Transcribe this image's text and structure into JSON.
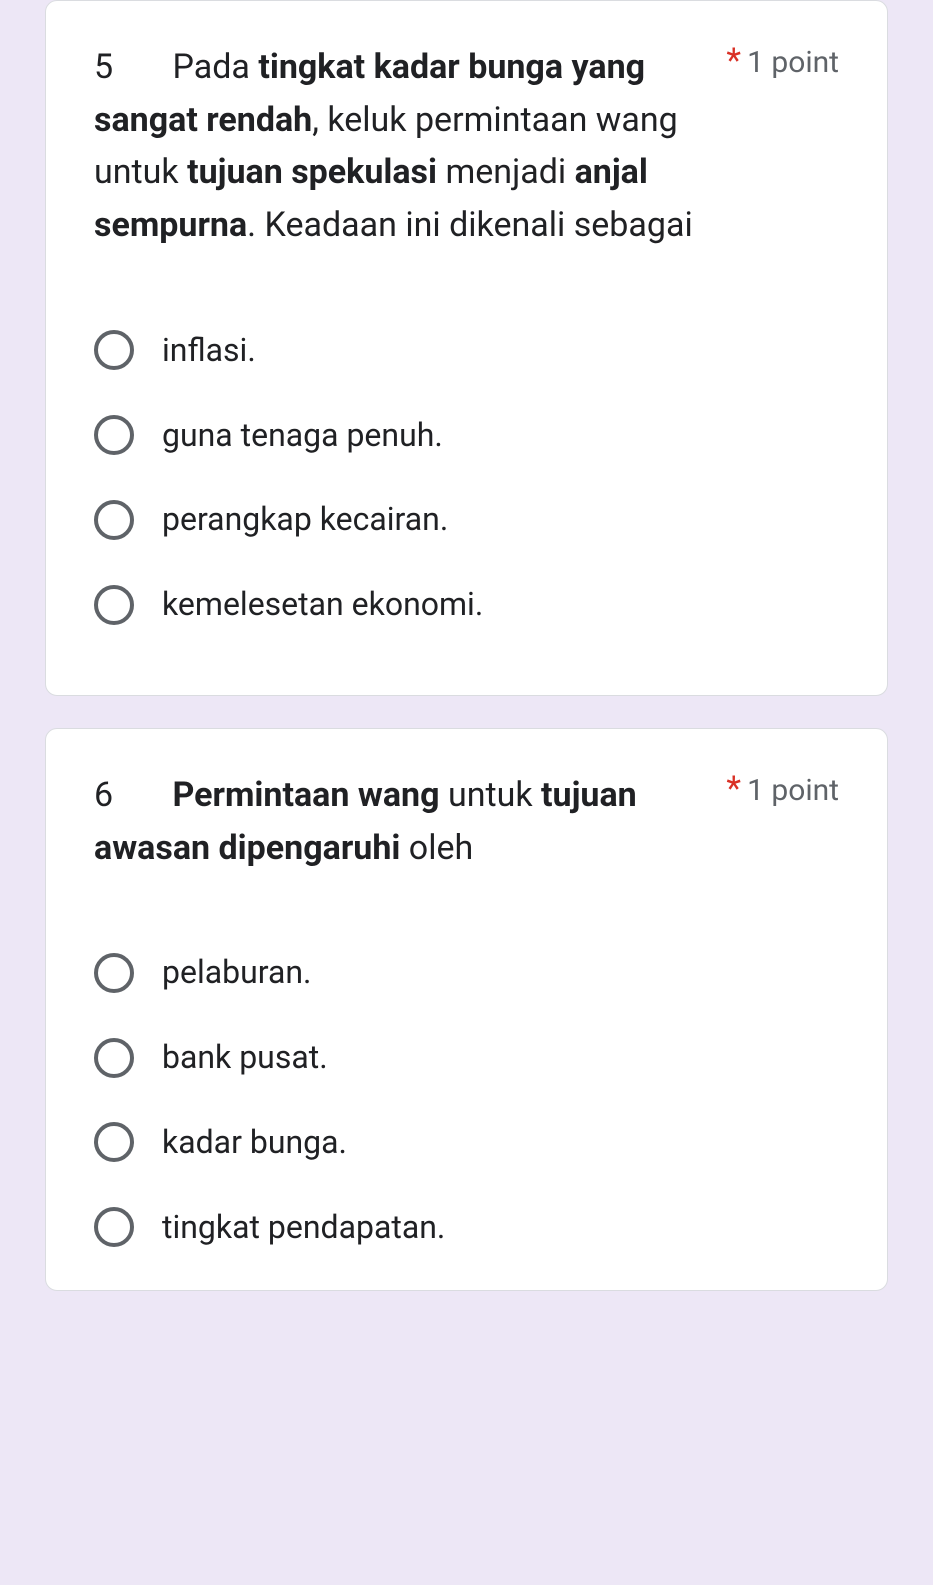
{
  "questions": [
    {
      "number": "5",
      "text_parts": [
        {
          "text": "Pada ",
          "bold": false
        },
        {
          "text": "tingkat kadar bunga yang sangat rendah",
          "bold": true
        },
        {
          "text": ", keluk permintaan wang untuk ",
          "bold": false
        },
        {
          "text": "tujuan spekulasi",
          "bold": true
        },
        {
          "text": " menjadi ",
          "bold": false
        },
        {
          "text": "anjal sempurna",
          "bold": true
        },
        {
          "text": ". Keadaan ini dikenali sebagai",
          "bold": false
        }
      ],
      "required_marker": "*",
      "points": "1 point",
      "options": [
        "inflasi.",
        "guna tenaga penuh.",
        "perangkap kecairan.",
        "kemelesetan ekonomi."
      ]
    },
    {
      "number": "6",
      "text_parts": [
        {
          "text": "Permintaan wang",
          "bold": true
        },
        {
          "text": " untuk ",
          "bold": false
        },
        {
          "text": "tujuan awasan dipengaruhi",
          "bold": true
        },
        {
          "text": " oleh",
          "bold": false
        }
      ],
      "required_marker": "*",
      "points": "1 point",
      "options": [
        "pelaburan.",
        "bank pusat.",
        "kadar bunga.",
        "tingkat pendapatan."
      ]
    }
  ]
}
